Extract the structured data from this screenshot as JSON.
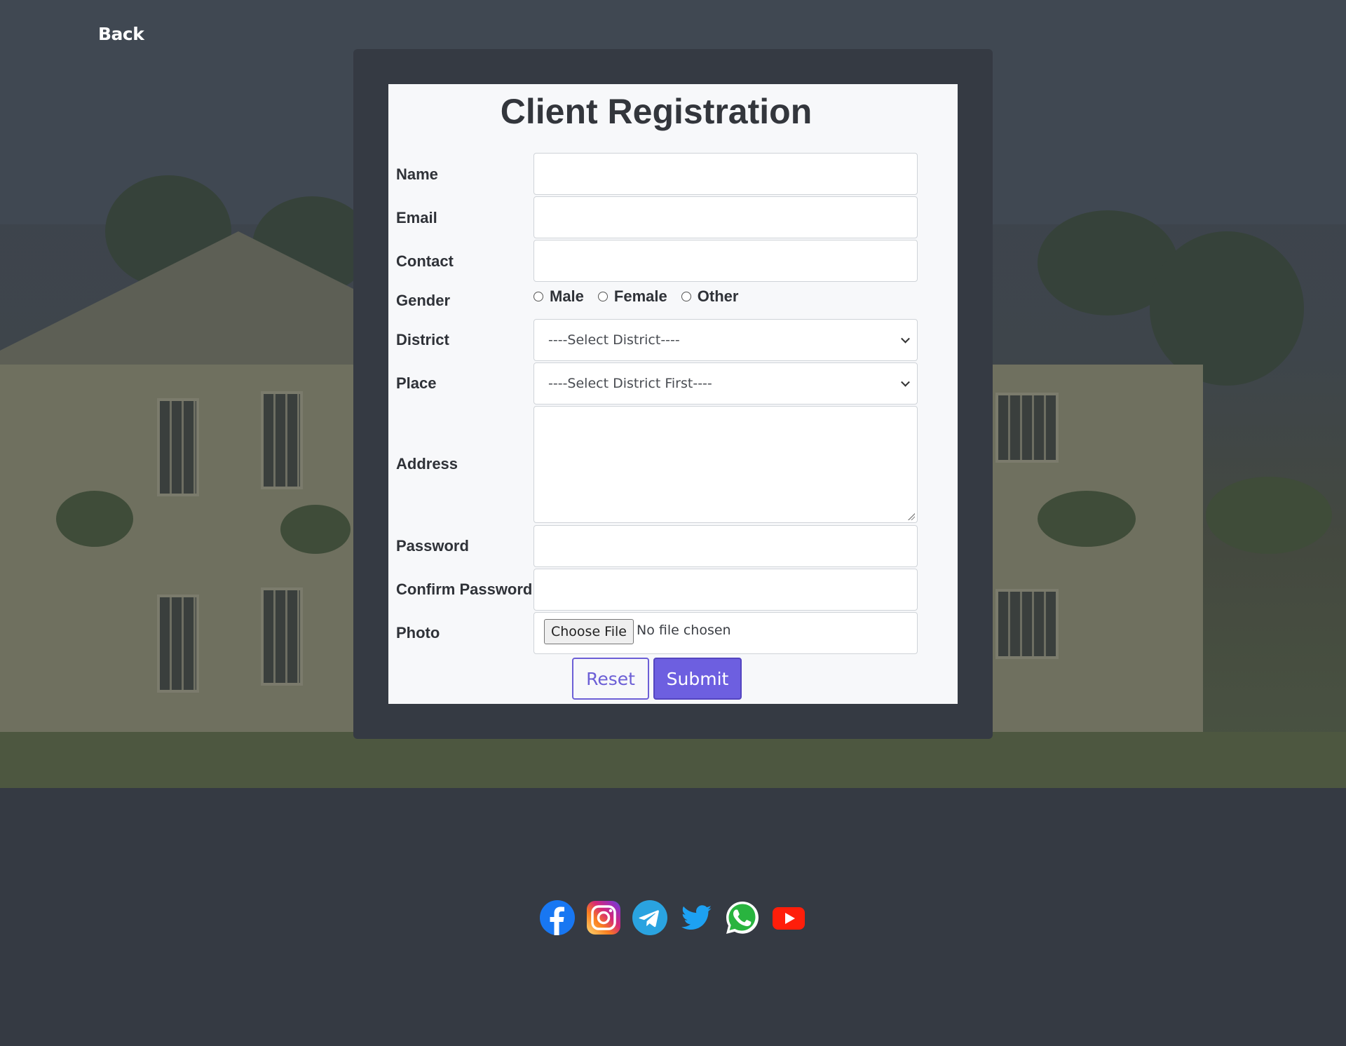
{
  "nav": {
    "back_label": "Back"
  },
  "form": {
    "title": "Client Registration",
    "fields": {
      "name": {
        "label": "Name",
        "value": ""
      },
      "email": {
        "label": "Email",
        "value": ""
      },
      "contact": {
        "label": "Contact",
        "value": ""
      },
      "gender": {
        "label": "Gender",
        "options": [
          "Male",
          "Female",
          "Other"
        ]
      },
      "district": {
        "label": "District",
        "selected": "----Select District----"
      },
      "place": {
        "label": "Place",
        "selected": "----Select District First----"
      },
      "address": {
        "label": "Address",
        "value": ""
      },
      "password": {
        "label": "Password",
        "value": ""
      },
      "confirm_password": {
        "label": "Confirm Password",
        "value": ""
      },
      "photo": {
        "label": "Photo",
        "button_label": "Choose File",
        "status": "No file chosen"
      }
    },
    "buttons": {
      "reset_label": "Reset",
      "submit_label": "Submit"
    },
    "colors": {
      "accent": "#6d5fe0",
      "page_bg": "#353a43",
      "card_bg": "#f7f8fa"
    }
  },
  "footer": {
    "social_icons": [
      "facebook-icon",
      "instagram-icon",
      "telegram-icon",
      "twitter-icon",
      "whatsapp-icon",
      "youtube-icon"
    ]
  }
}
